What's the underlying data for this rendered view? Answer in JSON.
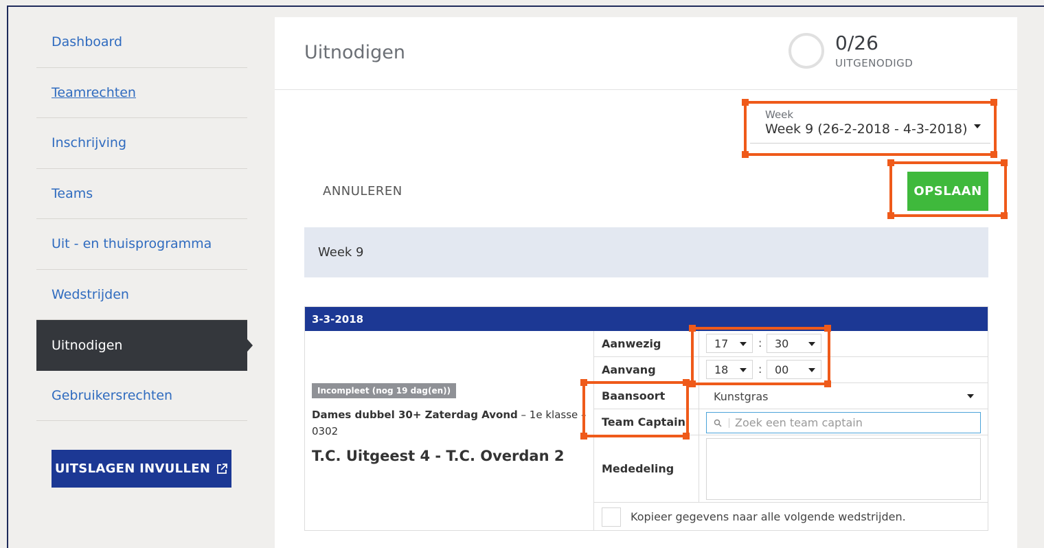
{
  "sidebar": {
    "items": [
      {
        "label": "Dashboard"
      },
      {
        "label": "Teamrechten"
      },
      {
        "label": "Inschrijving"
      },
      {
        "label": "Teams"
      },
      {
        "label": "Uit - en thuisprogramma"
      },
      {
        "label": "Wedstrijden"
      },
      {
        "label": "Uitnodigen"
      },
      {
        "label": "Gebruikersrechten"
      }
    ],
    "cta_label": "UITSLAGEN INVULLEN"
  },
  "header": {
    "title": "Uitnodigen",
    "progress_count": "0/26",
    "progress_label": "UITGENODIGD",
    "progress_fraction": 0
  },
  "week_select": {
    "label": "Week",
    "value": "Week 9 (26-2-2018 - 4-3-2018)"
  },
  "actions": {
    "cancel_label": "ANNULEREN",
    "save_label": "OPSLAAN"
  },
  "week_band": "Week 9",
  "match": {
    "date": "3-3-2018",
    "badge": "Incompleet (nog 19 dag(en))",
    "competition": "Dames dubbel 30+ Zaterdag Avond",
    "competition_detail": " – 1e klasse – 0302",
    "teams": "T.C. Uitgeest 4 - T.C. Overdan 2",
    "fields": {
      "present_label": "Aanwezig",
      "present_hour": "17",
      "present_minute": "30",
      "start_label": "Aanvang",
      "start_hour": "18",
      "start_minute": "00",
      "surface_label": "Baansoort",
      "surface_value": "Kunstgras",
      "captain_label": "Team Captain",
      "captain_placeholder": "Zoek een team captain",
      "message_label": "Mededeling",
      "copy_label": "Kopieer gegevens naar alle volgende wedstrijden."
    }
  },
  "colors": {
    "accent_blue": "#1c3894",
    "save_green": "#3fb93c",
    "annotation_orange": "#ef5a1a",
    "sidebar_active": "#34373c"
  }
}
